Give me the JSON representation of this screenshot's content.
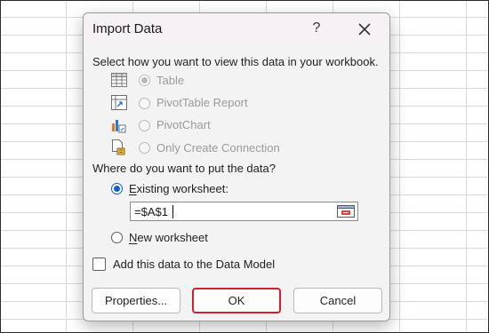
{
  "dialog": {
    "title": "Import Data",
    "help_label": "?",
    "prompt": "Select how you want to view this data in your workbook.",
    "view_options": [
      {
        "label": "Table",
        "icon": "table-icon",
        "checked": true,
        "enabled": false
      },
      {
        "label": "PivotTable Report",
        "icon": "pivottable-icon",
        "checked": false,
        "enabled": false
      },
      {
        "label": "PivotChart",
        "icon": "pivotchart-icon",
        "checked": false,
        "enabled": false
      },
      {
        "label": "Only Create Connection",
        "icon": "connection-only-icon",
        "checked": false,
        "enabled": false
      }
    ],
    "location_prompt": "Where do you want to put the data?",
    "existing_worksheet": {
      "label": "Existing worksheet:",
      "checked": true
    },
    "cell_reference": "=$A$1",
    "new_worksheet": {
      "label": "New worksheet",
      "checked": false
    },
    "data_model": {
      "label": "Add this data to the Data Model",
      "checked": false
    },
    "buttons": {
      "properties": "Properties...",
      "ok": "OK",
      "cancel": "Cancel"
    }
  },
  "colors": {
    "accent": "#0f62c9",
    "highlight": "#d11f2b",
    "titlebar": "#f7f1f6"
  }
}
